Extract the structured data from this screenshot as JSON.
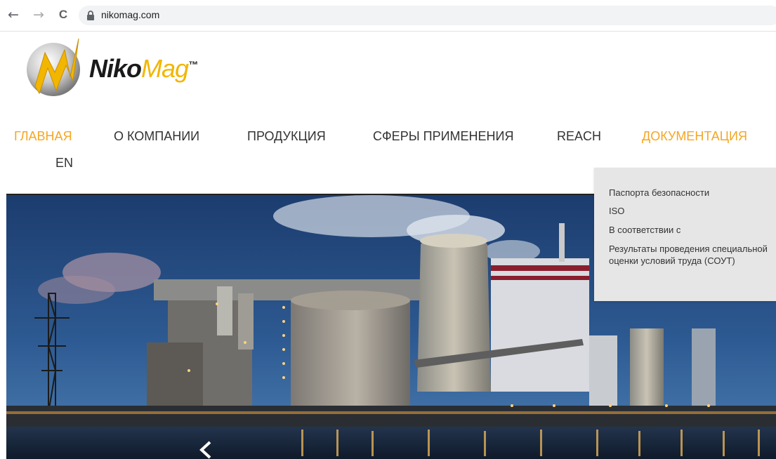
{
  "browser": {
    "url": "nikomag.com",
    "back_glyph": "←",
    "forward_glyph": "→",
    "reload_glyph": "C"
  },
  "logo": {
    "text_niko": "Niko",
    "text_mag": "Mag",
    "text_tm": "™"
  },
  "nav": {
    "items": [
      {
        "label": "ГЛАВНАЯ",
        "active": true
      },
      {
        "label": "О КОМПАНИИ",
        "active": false
      },
      {
        "label": "ПРОДУКЦИЯ",
        "active": false
      },
      {
        "label": "СФЕРЫ ПРИМЕНЕНИЯ",
        "active": false
      },
      {
        "label": "REACH",
        "active": false
      },
      {
        "label": "ДОКУМЕНТАЦИЯ",
        "active": true
      },
      {
        "label": "EN",
        "active": false
      }
    ]
  },
  "dropdown": {
    "items": [
      {
        "label": "Паспорта безопасности"
      },
      {
        "label": "ISO"
      },
      {
        "label": "В соответствии с"
      },
      {
        "label": "Результаты проведения специальной оценки условий труда (СОУТ)"
      }
    ]
  },
  "hero": {
    "prev_arrow_icon": "chevron-left-icon"
  },
  "colors": {
    "accent": "#f5a623",
    "logo_yellow": "#f2b600",
    "dropdown_bg": "#e6e6e6"
  }
}
